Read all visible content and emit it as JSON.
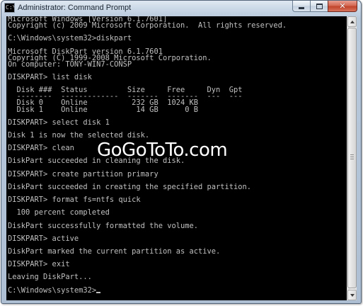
{
  "window": {
    "title": "Administrator: Command Prompt",
    "icon_name": "console-app-icon",
    "icon_glyph": "C:\\",
    "buttons": {
      "minimize_icon": "minimize-icon",
      "maximize_icon": "maximize-icon",
      "close_icon": "close-icon",
      "close_glyph": "✕"
    }
  },
  "console": {
    "background": "#000000",
    "foreground": "#c0c0c0",
    "lines": [
      "Microsoft Windows [Version 6.1.7601]",
      "Copyright (c) 2009 Microsoft Corporation.  All rights reserved.",
      "",
      "C:\\Windows\\system32>diskpart",
      "",
      "Microsoft DiskPart version 6.1.7601",
      "Copyright (C) 1999-2008 Microsoft Corporation.",
      "On computer: TONY-WIN7-CONSP",
      "",
      "DISKPART> list disk",
      "",
      "  Disk ###  Status         Size     Free     Dyn  Gpt",
      "  --------  -------------  -------  -------  ---  ---",
      "  Disk 0    Online          232 GB  1024 KB",
      "  Disk 1    Online           14 GB      0 B",
      "",
      "DISKPART> select disk 1",
      "",
      "Disk 1 is now the selected disk.",
      "",
      "DISKPART> clean",
      "",
      "DiskPart succeeded in cleaning the disk.",
      "",
      "DISKPART> create partition primary",
      "",
      "DiskPart succeeded in creating the specified partition.",
      "",
      "DISKPART> format fs=ntfs quick",
      "",
      "  100 percent completed",
      "",
      "DiskPart successfully formatted the volume.",
      "",
      "DISKPART> active",
      "",
      "DiskPart marked the current partition as active.",
      "",
      "DISKPART> exit",
      "",
      "Leaving DiskPart...",
      "",
      "C:\\Windows\\system32>"
    ]
  },
  "watermark": "GoGoToTo.com",
  "scrollbar": {
    "up_icon": "scroll-up-arrow-icon",
    "down_icon": "scroll-down-arrow-icon"
  },
  "colors": {
    "title_text": "#1d2733",
    "close_button": "#c2442c",
    "console_bg": "#000000",
    "console_fg": "#c0c0c0"
  }
}
